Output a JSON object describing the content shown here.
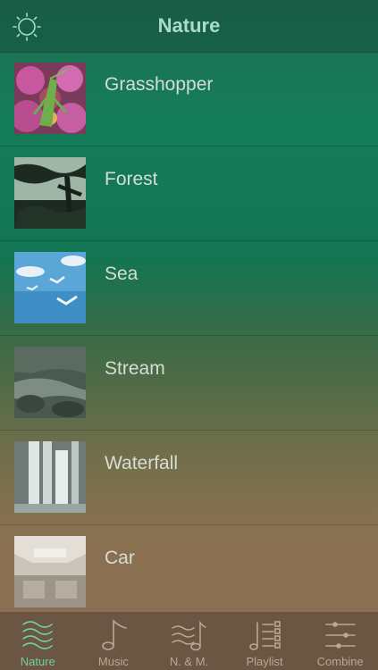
{
  "header": {
    "title": "Nature",
    "left_icon": "sun-icon"
  },
  "items": [
    {
      "label": "Grasshopper",
      "thumb": "grasshopper"
    },
    {
      "label": "Forest",
      "thumb": "forest"
    },
    {
      "label": "Sea",
      "thumb": "sea"
    },
    {
      "label": "Stream",
      "thumb": "stream"
    },
    {
      "label": "Waterfall",
      "thumb": "waterfall"
    },
    {
      "label": "Car",
      "thumb": "car"
    }
  ],
  "tabs": [
    {
      "label": "Nature",
      "icon": "waves-icon",
      "active": true
    },
    {
      "label": "Music",
      "icon": "music-note-icon",
      "active": false
    },
    {
      "label": "N. & M.",
      "icon": "waves-note-icon",
      "active": false
    },
    {
      "label": "Playlist",
      "icon": "playlist-icon",
      "active": false
    },
    {
      "label": "Combine",
      "icon": "sliders-icon",
      "active": false
    }
  ],
  "colors": {
    "active_tab": "#6fcf9b",
    "inactive_tab": "#b8a894",
    "tabbar_bg": "#6b5644"
  }
}
